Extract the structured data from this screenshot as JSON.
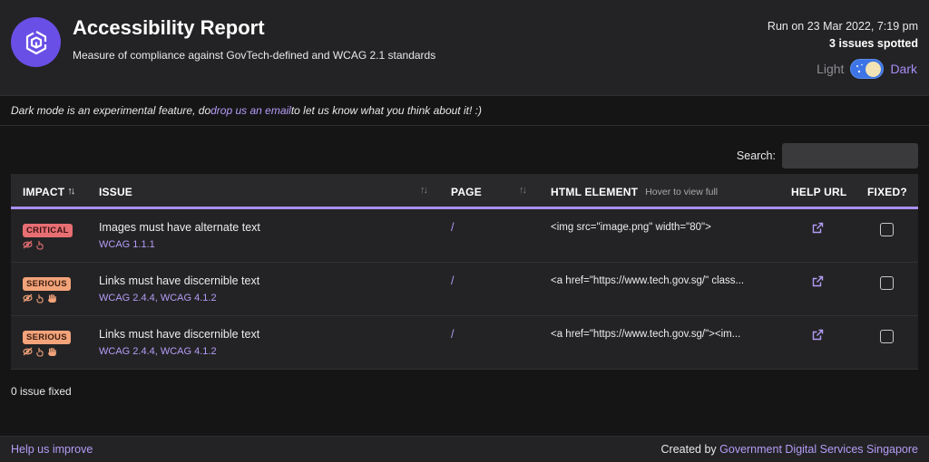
{
  "header": {
    "title": "Accessibility Report",
    "subtitle": "Measure of compliance against GovTech-defined and WCAG 2.1 standards",
    "run_info": "Run on 23 Mar 2022, 7:19 pm",
    "issues_spotted": "3 issues spotted",
    "theme_light_label": "Light",
    "theme_dark_label": "Dark",
    "logo_icon": "report-cube-icon",
    "accent_color": "#6a4fe6"
  },
  "banner": {
    "text_before": "Dark mode is an experimental feature, do ",
    "link_text": "drop us an email",
    "text_after": " to let us know what you think about it! :)"
  },
  "search": {
    "label": "Search:",
    "value": "",
    "placeholder": ""
  },
  "table": {
    "columns": {
      "impact": "IMPACT",
      "issue": "ISSUE",
      "page": "PAGE",
      "html_element": "HTML ELEMENT",
      "html_element_hint": "Hover to view full",
      "help_url": "HELP URL",
      "fixed": "FIXED?"
    },
    "rows": [
      {
        "impact": "CRITICAL",
        "impact_level": "critical",
        "impact_icons": [
          "eye-slash-icon",
          "pointer-hand-icon"
        ],
        "issue": "Images must have alternate text",
        "wcag": "WCAG 1.1.1",
        "page": "/",
        "html_element": "<img src=\"image.png\" width=\"80\">",
        "fixed": false
      },
      {
        "impact": "SERIOUS",
        "impact_level": "serious",
        "impact_icons": [
          "eye-slash-icon",
          "pointer-hand-icon",
          "palm-hand-icon"
        ],
        "issue": "Links must have discernible text",
        "wcag": "WCAG 2.4.4, WCAG 4.1.2",
        "page": "/",
        "html_element": "<a href=\"https://www.tech.gov.sg/\" class...",
        "fixed": false
      },
      {
        "impact": "SERIOUS",
        "impact_level": "serious",
        "impact_icons": [
          "eye-slash-icon",
          "pointer-hand-icon",
          "palm-hand-icon"
        ],
        "issue": "Links must have discernible text",
        "wcag": "WCAG 2.4.4, WCAG 4.1.2",
        "page": "/",
        "html_element": "<a href=\"https://www.tech.gov.sg/\"><im...",
        "fixed": false
      }
    ]
  },
  "fixed_count": "0 issue fixed",
  "footer": {
    "help_link": "Help us improve",
    "credit_prefix": "Created by ",
    "credit_org": "Government Digital Services Singapore"
  }
}
